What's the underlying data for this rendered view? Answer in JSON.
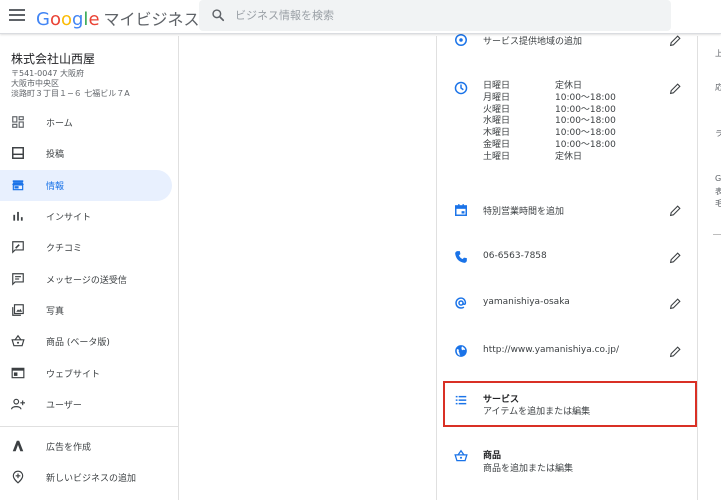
{
  "header": {
    "logo_letters": [
      "G",
      "o",
      "o",
      "g",
      "l",
      "e"
    ],
    "product_name": "マイビジネス",
    "search_placeholder": "ビジネス情報を検索"
  },
  "business": {
    "name": "株式会社山西屋",
    "address_lines": [
      "〒541-0047 大阪府",
      "大阪市中央区",
      "淡路町３丁目１−６ 七福ビル７A"
    ]
  },
  "nav": {
    "items": [
      {
        "label": "ホーム",
        "icon": "dashboard-icon"
      },
      {
        "label": "投稿",
        "icon": "posts-icon"
      },
      {
        "label": "情報",
        "icon": "storefront-icon"
      },
      {
        "label": "インサイト",
        "icon": "insights-icon"
      },
      {
        "label": "クチコミ",
        "icon": "reviews-icon"
      },
      {
        "label": "メッセージの送受信",
        "icon": "message-icon"
      },
      {
        "label": "写真",
        "icon": "photos-icon"
      },
      {
        "label": "商品 (ベータ版)",
        "icon": "basket-icon"
      },
      {
        "label": "ウェブサイト",
        "icon": "website-icon"
      },
      {
        "label": "ユーザー",
        "icon": "add-user-icon"
      },
      {
        "label": "広告を作成",
        "icon": "ads-icon"
      },
      {
        "label": "新しいビジネスの追加",
        "icon": "add-location-icon"
      }
    ],
    "active_index": 2
  },
  "info": {
    "service_area_label": "サービス提供地域の追加",
    "hours": [
      {
        "day": "日曜日",
        "time": "定休日"
      },
      {
        "day": "月曜日",
        "time": "10:00～18:00"
      },
      {
        "day": "火曜日",
        "time": "10:00～18:00"
      },
      {
        "day": "水曜日",
        "time": "10:00～18:00"
      },
      {
        "day": "木曜日",
        "time": "10:00～18:00"
      },
      {
        "day": "金曜日",
        "time": "10:00～18:00"
      },
      {
        "day": "土曜日",
        "time": "定休日"
      }
    ],
    "special_hours_label": "特別営業時間を追加",
    "phone": "06-6563-7858",
    "short_name": "yamanishiya-osaka",
    "website": "http://www.yamanishiya.co.jp/",
    "services": {
      "title": "サービス",
      "subtitle": "アイテムを追加または編集"
    },
    "products": {
      "title": "商品",
      "subtitle": "商品を追加または編集"
    }
  },
  "right_panel": {
    "fragments": [
      "上",
      "応",
      "ラ",
      "G",
      "表",
      "毛"
    ]
  },
  "colors": {
    "accent": "#1a73e8",
    "active_bg": "#e8f0fe",
    "highlight_border": "#d93025",
    "icon_blue": "#1a73e8"
  }
}
